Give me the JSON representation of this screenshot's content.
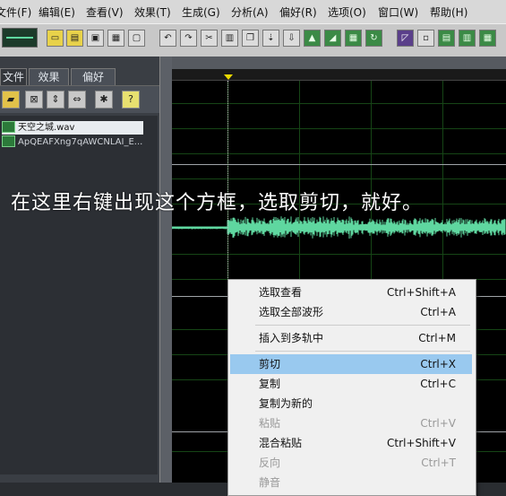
{
  "menubar": {
    "items": [
      "文件(F)",
      "编辑(E)",
      "查看(V)",
      "效果(T)",
      "生成(G)",
      "分析(A)",
      "偏好(R)",
      "选项(O)",
      "窗口(W)",
      "帮助(H)"
    ]
  },
  "left_panel": {
    "tabs": [
      "文件",
      "效果",
      "偏好"
    ],
    "files": [
      "天空之城.wav",
      "ApQEAFXng7qAWCNLAI_E..."
    ]
  },
  "annotation": "在这里右键出现这个方框，选取剪切，就好。",
  "context_menu": {
    "items": [
      {
        "label": "选取查看",
        "shortcut": "Ctrl+Shift+A"
      },
      {
        "label": "选取全部波形",
        "shortcut": "Ctrl+A"
      },
      {
        "label": "插入到多轨中",
        "shortcut": "Ctrl+M"
      },
      {
        "label": "剪切",
        "shortcut": "Ctrl+X"
      },
      {
        "label": "复制",
        "shortcut": "Ctrl+C"
      },
      {
        "label": "复制为新的",
        "shortcut": ""
      },
      {
        "label": "粘贴",
        "shortcut": "Ctrl+V"
      },
      {
        "label": "混合粘贴",
        "shortcut": "Ctrl+Shift+V"
      },
      {
        "label": "反向",
        "shortcut": "Ctrl+T"
      },
      {
        "label": "静音",
        "shortcut": ""
      }
    ],
    "highlighted_index": 3,
    "disabled_indices": [
      6,
      8,
      9
    ]
  },
  "colors": {
    "waveform": "#5fd7a0",
    "highlight": "#99c9ef",
    "cursor_marker": "#e8d800"
  }
}
